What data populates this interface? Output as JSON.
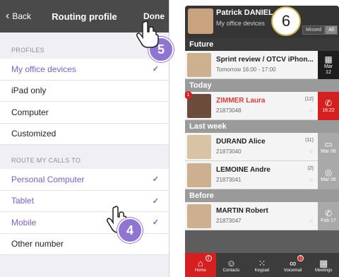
{
  "left": {
    "nav": {
      "back": "Back",
      "title": "Routing profile",
      "done": "Done"
    },
    "profiles_header": "PROFILES",
    "profiles": [
      {
        "label": "My office devices",
        "checked": true
      },
      {
        "label": "iPad only",
        "checked": false
      },
      {
        "label": "Computer",
        "checked": false
      },
      {
        "label": "Customized",
        "checked": false
      }
    ],
    "route_header": "ROUTE MY CALLS TO",
    "routes": [
      {
        "label": "Personal Computer",
        "checked": true
      },
      {
        "label": "Tablet",
        "checked": true
      },
      {
        "label": "Mobile",
        "checked": true
      },
      {
        "label": "Other number",
        "checked": false
      }
    ],
    "check_glyph": "✓"
  },
  "steps": {
    "step4": "4",
    "step5": "5",
    "step6": "6"
  },
  "right": {
    "user": {
      "name": "Patrick DANIEL",
      "status": "My office devices"
    },
    "tabs": [
      "Missed",
      "All"
    ],
    "sections": {
      "future": "Future",
      "today": "Today",
      "last_week": "Last week",
      "before": "Before"
    },
    "future_item": {
      "title": "Sprint review / OTCV iPhon...",
      "time": "Tomorrow 16:00 - 17:00",
      "date_month": "Mar",
      "date_day": "12"
    },
    "today_item": {
      "name": "ZIMMER Laura",
      "number": "21873048",
      "count": "(12)",
      "time": "16:22",
      "badge": "1"
    },
    "last_week_items": [
      {
        "name": "DURAND Alice",
        "number": "21873040",
        "count": "(11)",
        "date": "Mar 06"
      },
      {
        "name": "LEMOINE Andre",
        "number": "21873041",
        "count": "(2)",
        "date": "Mar 06"
      }
    ],
    "before_item": {
      "name": "MARTIN Robert",
      "number": "21873047",
      "date": "Feb 17"
    },
    "tabbar": [
      {
        "label": "Home",
        "badge": "1"
      },
      {
        "label": "Contacts",
        "badge": ""
      },
      {
        "label": "Keypad",
        "badge": ""
      },
      {
        "label": "Voicemail",
        "badge": "1"
      },
      {
        "label": "Meetings",
        "badge": ""
      }
    ]
  }
}
